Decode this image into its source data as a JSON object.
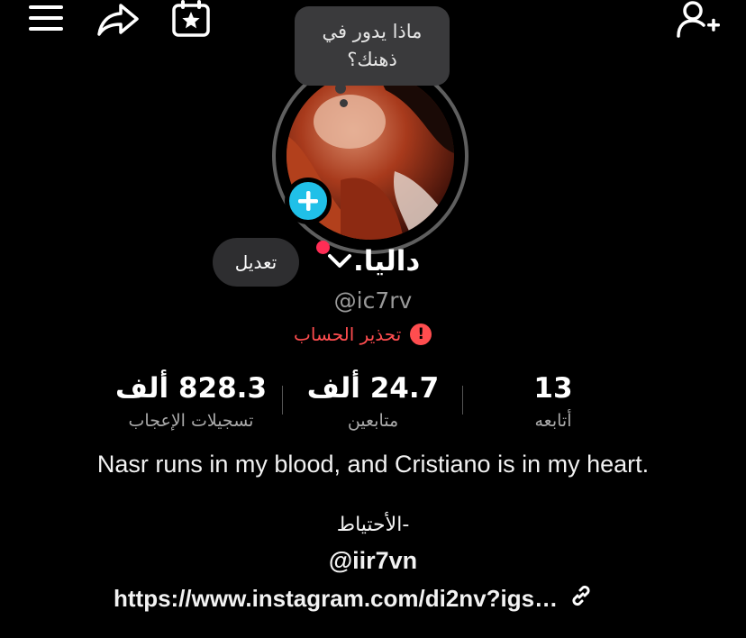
{
  "note": {
    "text": "ماذا يدور في ذهنك؟"
  },
  "profile": {
    "edit_label": "تعديل",
    "display_name": "داليا.",
    "username": "@ic7rv",
    "warning": "تحذير الحساب",
    "warning_glyph": "!"
  },
  "stats": [
    {
      "value": "828.3 ألف",
      "label": "تسجيلات الإعجاب"
    },
    {
      "value": "24.7 ألف",
      "label": "متابعين"
    },
    {
      "value": "13",
      "label": "أتابعه"
    }
  ],
  "bio": {
    "line1": "Nasr runs in my blood, and Cristiano is in my heart.",
    "line2": "-الأحتياط",
    "mention": "@iir7vn",
    "link": "https://www.instagram.com/di2nv?igs…"
  },
  "colors": {
    "accent": "#20c0e8",
    "live": "#ff2d55",
    "warning": "#ff4d4f"
  },
  "icons": [
    "menu-icon",
    "share-icon",
    "calendar-star-icon",
    "add-user-icon",
    "chevron-down-icon",
    "plus-icon",
    "warning-icon",
    "link-icon"
  ]
}
